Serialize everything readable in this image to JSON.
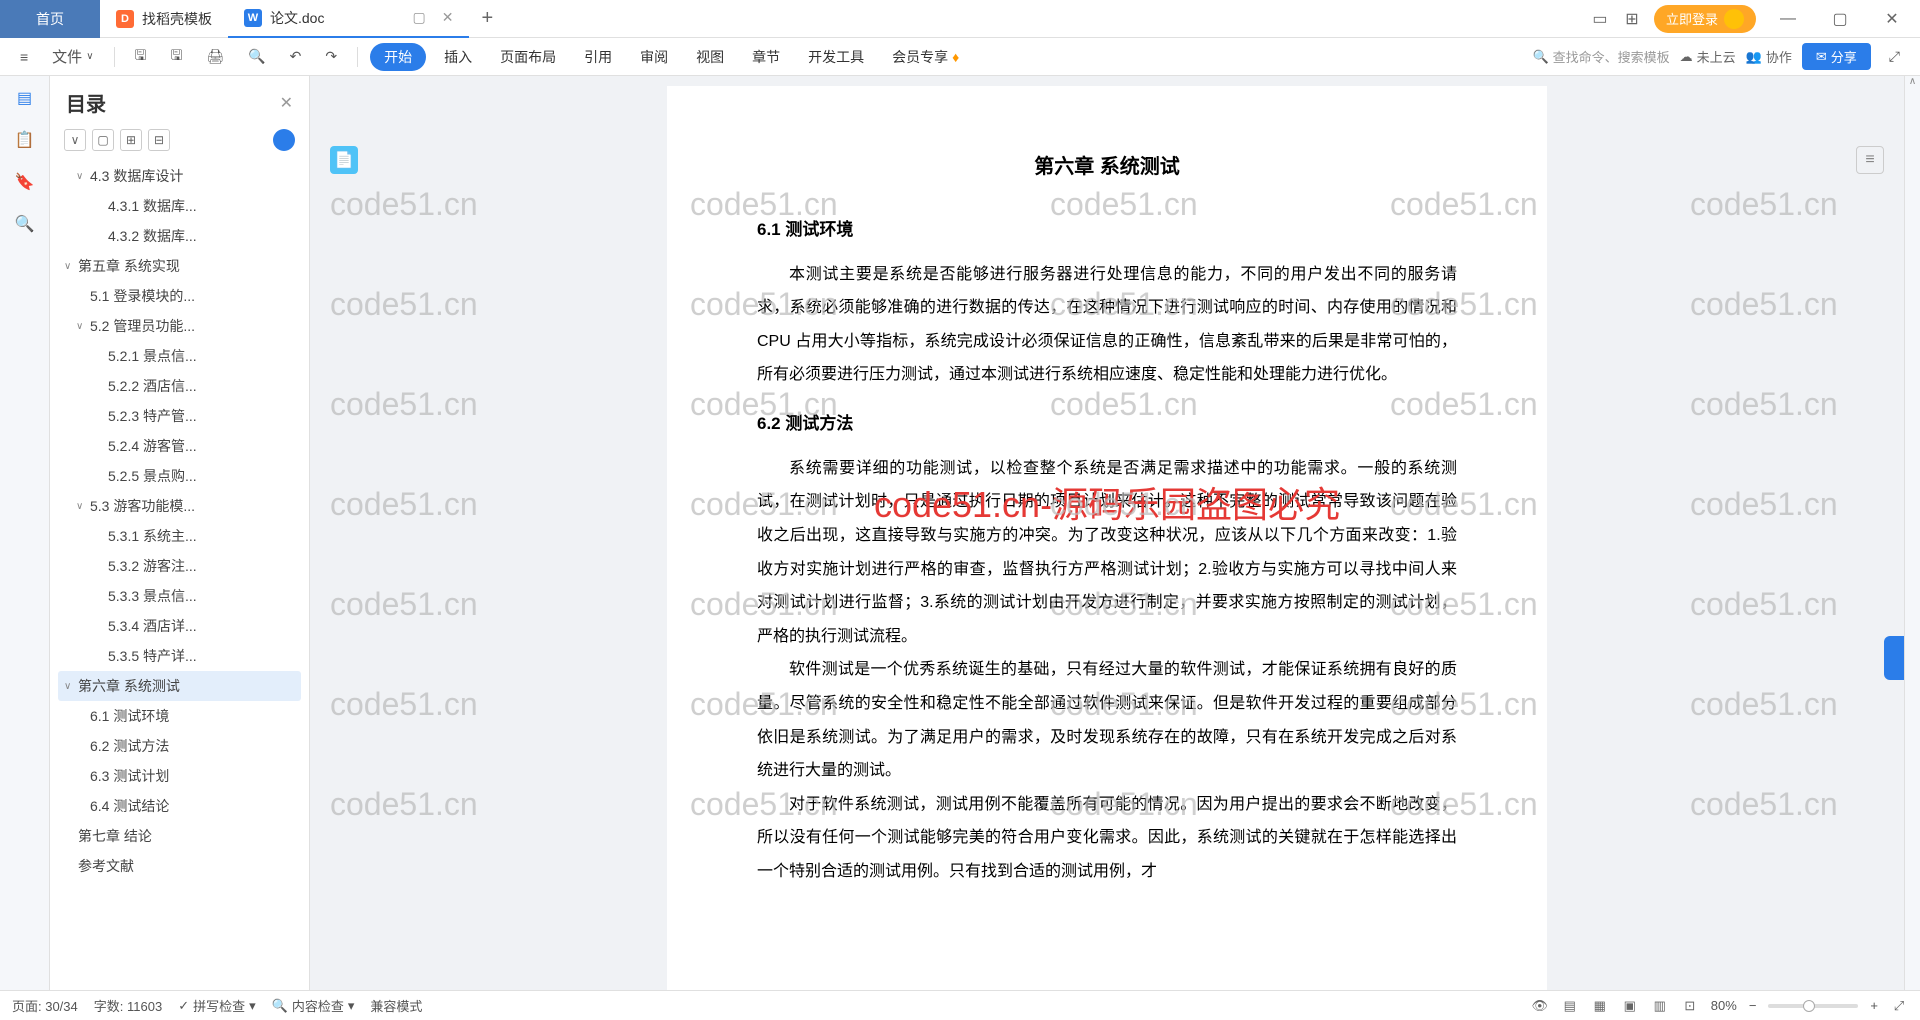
{
  "titlebar": {
    "tabs": [
      {
        "label": "首页",
        "type": "home"
      },
      {
        "label": "找稻壳模板",
        "icon": "D"
      },
      {
        "label": "论文.doc",
        "icon": "W",
        "active": true
      }
    ],
    "login_label": "立即登录"
  },
  "toolbar": {
    "menu_icon": "≡",
    "file_label": "文件",
    "start_label": "开始",
    "menus": [
      "插入",
      "页面布局",
      "引用",
      "审阅",
      "视图",
      "章节",
      "开发工具",
      "会员专享"
    ],
    "search_placeholder": "查找命令、搜索模板",
    "cloud_label": "未上云",
    "collab_label": "协作",
    "share_label": "分享"
  },
  "outline": {
    "title": "目录",
    "items": [
      {
        "label": "4.3 数据库设计",
        "level": 1,
        "toggle": "∨"
      },
      {
        "label": "4.3.1 数据库...",
        "level": 2
      },
      {
        "label": "4.3.2 数据库...",
        "level": 2
      },
      {
        "label": "第五章  系统实现",
        "level": 0,
        "toggle": "∨"
      },
      {
        "label": "5.1 登录模块的...",
        "level": 1
      },
      {
        "label": "5.2 管理员功能...",
        "level": 1,
        "toggle": "∨"
      },
      {
        "label": "5.2.1 景点信...",
        "level": 2
      },
      {
        "label": "5.2.2 酒店信...",
        "level": 2
      },
      {
        "label": "5.2.3 特产管...",
        "level": 2
      },
      {
        "label": "5.2.4 游客管...",
        "level": 2
      },
      {
        "label": "5.2.5 景点购...",
        "level": 2
      },
      {
        "label": "5.3 游客功能模...",
        "level": 1,
        "toggle": "∨"
      },
      {
        "label": "5.3.1 系统主...",
        "level": 2
      },
      {
        "label": "5.3.2 游客注...",
        "level": 2
      },
      {
        "label": "5.3.3 景点信...",
        "level": 2
      },
      {
        "label": "5.3.4 酒店详...",
        "level": 2
      },
      {
        "label": "5.3.5 特产详...",
        "level": 2
      },
      {
        "label": "第六章  系统测试",
        "level": 0,
        "toggle": "∨",
        "selected": true
      },
      {
        "label": "6.1 测试环境",
        "level": 1
      },
      {
        "label": "6.2 测试方法",
        "level": 1
      },
      {
        "label": "6.3 测试计划",
        "level": 1
      },
      {
        "label": "6.4 测试结论",
        "level": 1
      },
      {
        "label": "第七章  结论",
        "level": 0
      },
      {
        "label": "参考文献",
        "level": 0
      }
    ]
  },
  "document": {
    "chapter_title": "第六章  系统测试",
    "section1_title": "6.1 测试环境",
    "para1": "本测试主要是系统是否能够进行服务器进行处理信息的能力，不同的用户发出不同的服务请求，系统必须能够准确的进行数据的传达，在这种情况下进行测试响应的时间、内存使用的情况和 CPU 占用大小等指标，系统完成设计必须保证信息的正确性，信息紊乱带来的后果是非常可怕的，所有必须要进行压力测试，通过本测试进行系统相应速度、稳定性能和处理能力进行优化。",
    "section2_title": "6.2 测试方法",
    "para2": "系统需要详细的功能测试，以检查整个系统是否满足需求描述中的功能需求。一般的系统测试，在测试计划时，只是通过执行日期的项目计划来估计。这种不完整的测试常常导致该问题在验收之后出现，这直接导致与实施方的冲突。为了改变这种状况，应该从以下几个方面来改变：1.验收方对实施计划进行严格的审查，监督执行方严格测试计划；2.验收方与实施方可以寻找中间人来对测试计划进行监督；3.系统的测试计划由开发方进行制定，并要求实施方按照制定的测试计划，严格的执行测试流程。",
    "para3": "软件测试是一个优秀系统诞生的基础，只有经过大量的软件测试，才能保证系统拥有良好的质量。尽管系统的安全性和稳定性不能全部通过软件测试来保证。但是软件开发过程的重要组成部分依旧是系统测试。为了满足用户的需求，及时发现系统存在的故障，只有在系统开发完成之后对系统进行大量的测试。",
    "para4": "对于软件系统测试，测试用例不能覆盖所有可能的情况。因为用户提出的要求会不断地改变，所以没有任何一个测试能够完美的符合用户变化需求。因此，系统测试的关键就在于怎样能选择出一个特别合适的测试用例。只有找到合适的测试用例，才"
  },
  "watermark": {
    "text": "code51.cn",
    "red_text": "code51.cn-源码乐园盗图必究"
  },
  "statusbar": {
    "page_label": "页面: 30/34",
    "word_label": "字数: 11603",
    "spell_label": "拼写检查",
    "content_label": "内容检查",
    "compat_label": "兼容模式",
    "zoom_label": "80%"
  }
}
